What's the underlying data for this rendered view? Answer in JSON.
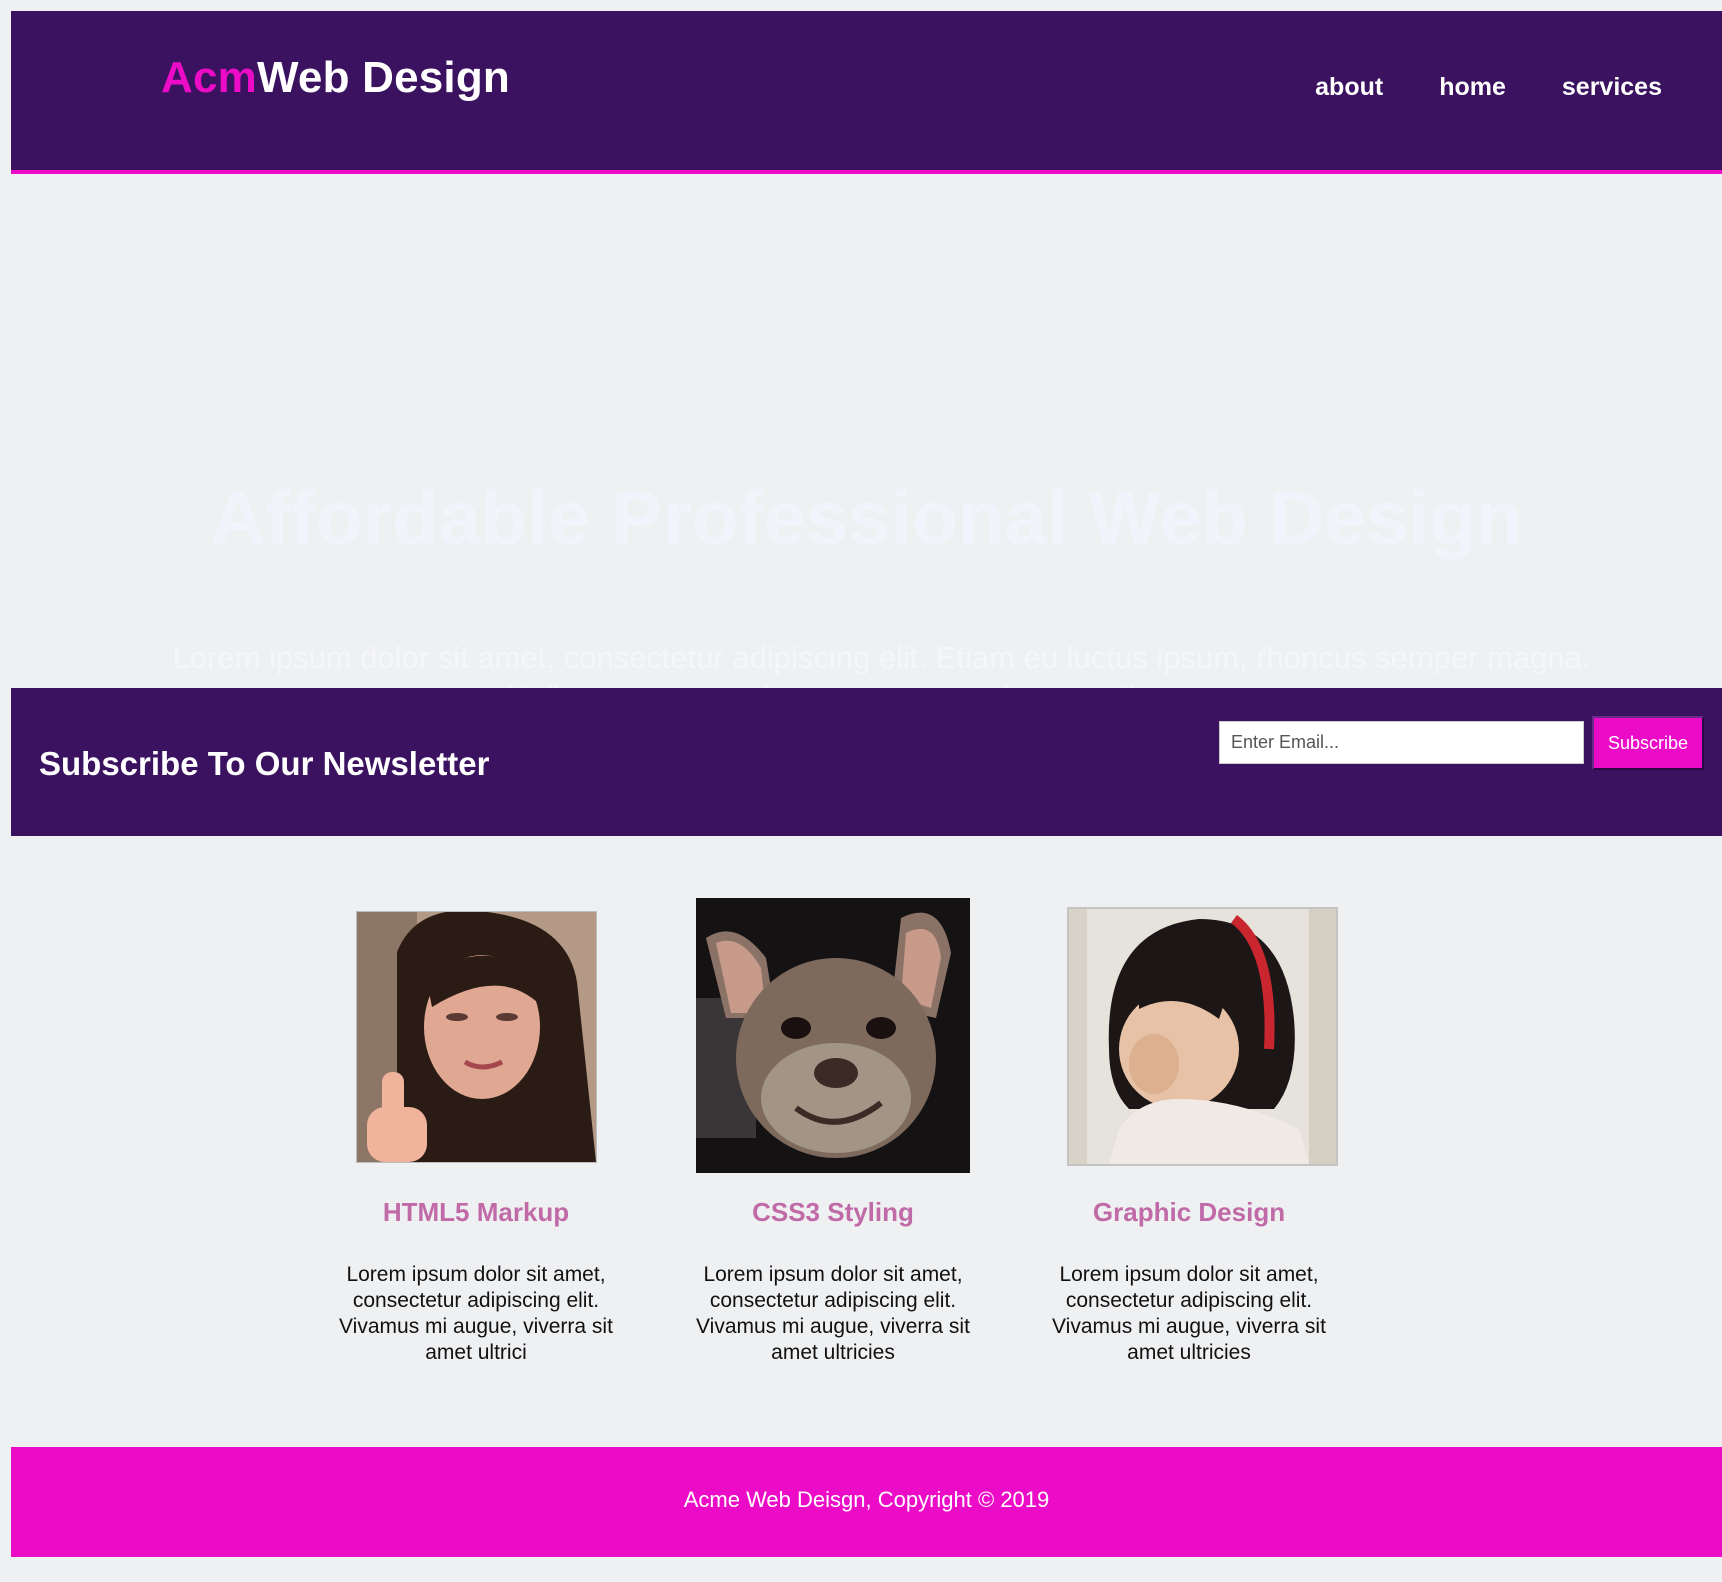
{
  "header": {
    "brand_accent": "Acm",
    "brand_rest": "Web Design",
    "nav": [
      "about",
      "home",
      "services"
    ]
  },
  "showcase": {
    "title": "Affordable Professional Web Design",
    "text": "Lorem ipsum dolor sit amet, consectetur adipiscing elit. Etiam eu luctus ipsum, rhoncus semper magna. Nulla nec magna sit amet sem interdum condimentum."
  },
  "newsletter": {
    "title": "Subscribe To Our Newsletter",
    "email_placeholder": "Enter Email...",
    "button": "Subscribe"
  },
  "boxes": [
    {
      "title": "HTML5 Markup",
      "text": "Lorem ipsum dolor sit amet, consectetur adipiscing elit. Vivamus mi augue, viverra sit amet ultrici",
      "image": "crying-thumbs-up-photo"
    },
    {
      "title": "CSS3 Styling",
      "text": "Lorem ipsum dolor sit amet, consectetur adipiscing elit. Vivamus mi augue, viverra sit amet ultricies",
      "image": "smiling-dog-photo"
    },
    {
      "title": "Graphic Design",
      "text": "Lorem ipsum dolor sit amet, consectetur adipiscing elit. Vivamus mi augue, viverra sit amet ultricies",
      "image": "crying-child-photo"
    }
  ],
  "footer": {
    "text": "Acme Web Deisgn, Copyright © 2019"
  },
  "colors": {
    "header_bg": "#3b1260",
    "accent": "#ec0cc7",
    "page_bg": "#eff0f2",
    "box_title": "#c06aa8"
  }
}
